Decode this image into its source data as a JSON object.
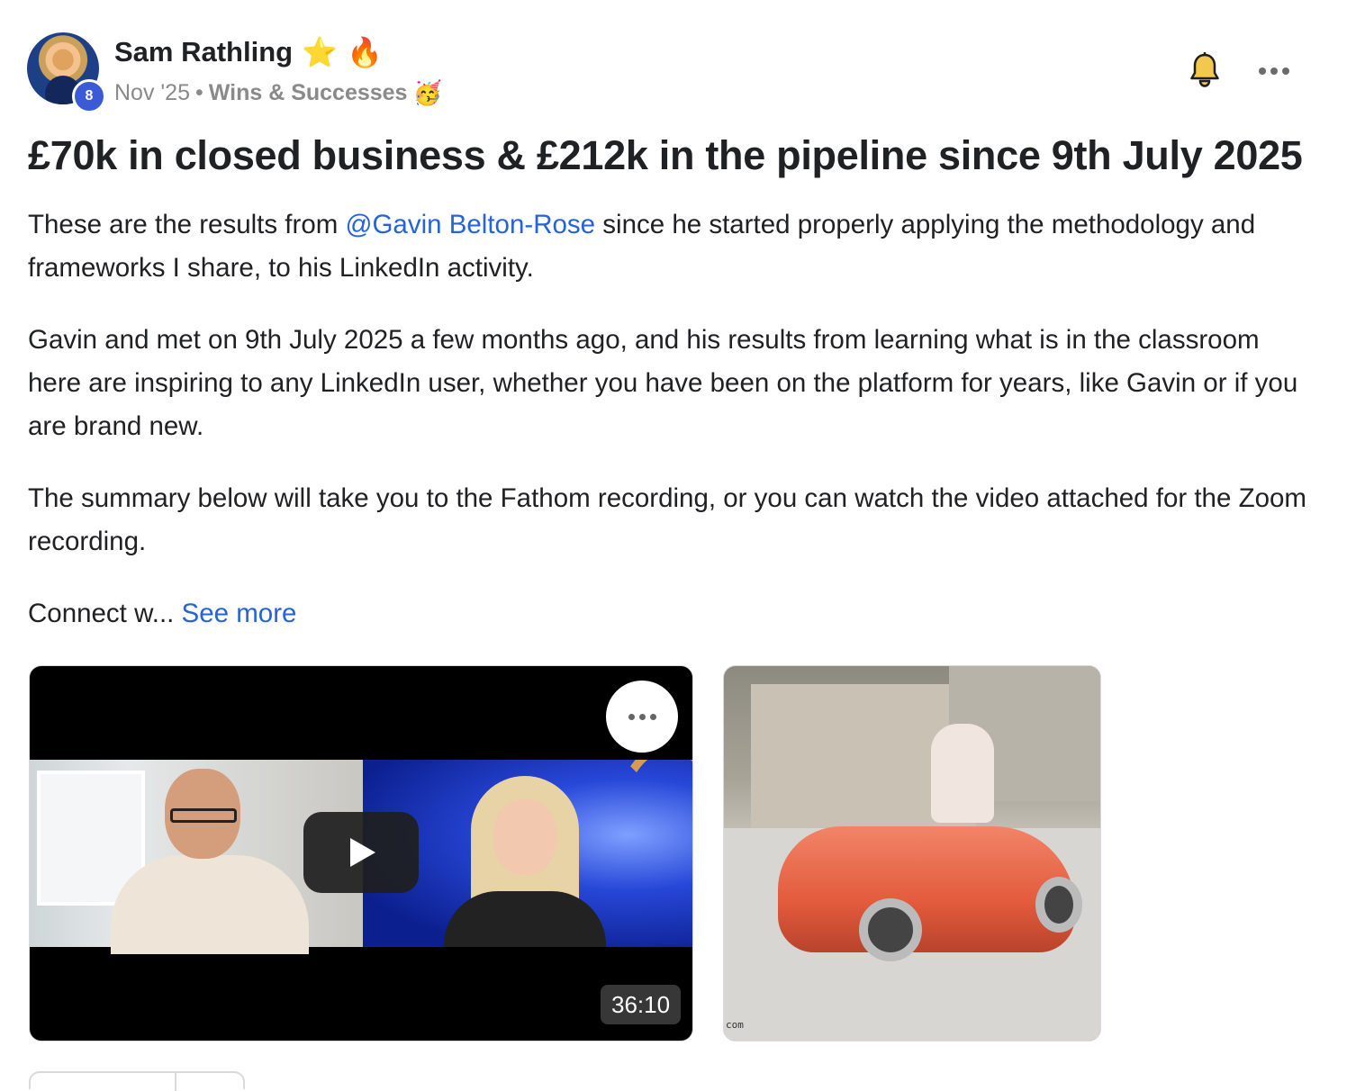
{
  "post": {
    "author": {
      "name": "Sam Rathling",
      "badges": [
        "⭐",
        "🔥"
      ],
      "level": "8"
    },
    "meta": {
      "date": "Nov '25",
      "separator": "•",
      "category": "Wins & Successes",
      "category_emoji": "🥳"
    },
    "title": "£70k in closed business & £212k in the pipeline since 9th July 2025",
    "body": {
      "p1_before": "These are the results from ",
      "p1_mention": "@Gavin Belton-Rose",
      "p1_after": " since he started properly applying the methodology and frameworks I share, to his LinkedIn activity.",
      "p2": "Gavin and met on 9th July 2025 a few months ago, and his results from learning what is in the classroom here are inspiring to any LinkedIn user, whether you have been on the platform for years, like Gavin or if you are brand new.",
      "p3": "The summary below will take you to the Fathom recording, or you can watch the video attached for the Zoom recording.",
      "p4_truncated": "Connect w... ",
      "see_more": "See more"
    },
    "video": {
      "duration": "36:10"
    },
    "gif": {
      "watermark": "com"
    }
  },
  "icons": {
    "bell": "bell-icon",
    "more": "more-horizontal-icon",
    "play": "play-icon"
  },
  "colors": {
    "link": "#2563d9",
    "level_badge": "#3b5bd6",
    "bell": "#f2c94c"
  }
}
